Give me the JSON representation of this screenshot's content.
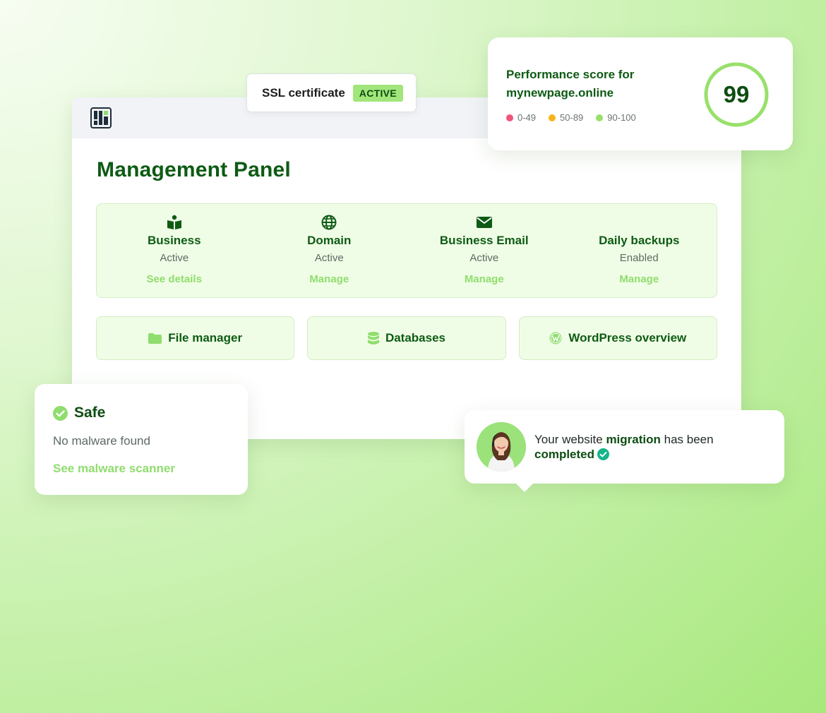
{
  "ssl": {
    "label": "SSL certificate",
    "badge": "ACTIVE"
  },
  "performance": {
    "title_line1": "Performance score for",
    "title_line2": "mynewpage.online",
    "score": "99",
    "score_fraction": 0.99,
    "legend": [
      {
        "label": "0-49",
        "color": "#f0547b"
      },
      {
        "label": "50-89",
        "color": "#f8b41c"
      },
      {
        "label": "90-100",
        "color": "#98e06b"
      }
    ]
  },
  "panel": {
    "title": "Management Panel",
    "services": [
      {
        "name": "Business",
        "status": "Active",
        "link": "See details",
        "icon": "book-user-icon"
      },
      {
        "name": "Domain",
        "status": "Active",
        "link": "Manage",
        "icon": "globe-icon"
      },
      {
        "name": "Business Email",
        "status": "Active",
        "link": "Manage",
        "icon": "envelope-icon"
      },
      {
        "name": "Daily backups",
        "status": "Enabled",
        "link": "Manage",
        "icon": ""
      }
    ],
    "tools": [
      {
        "label": "File manager",
        "icon": "folder-icon"
      },
      {
        "label": "Databases",
        "icon": "database-icon"
      },
      {
        "label": "WordPress overview",
        "icon": "wordpress-icon"
      }
    ]
  },
  "safe": {
    "title": "Safe",
    "text": "No malware found",
    "link": "See malware scanner"
  },
  "migration": {
    "prefix": "Your website ",
    "bold1": "migration",
    "middle": " has been",
    "bold2": "completed"
  },
  "colors": {
    "brand_dark": "#0d5b14",
    "accent_green": "#8fdd6e",
    "badge_green": "#a2e57a"
  }
}
